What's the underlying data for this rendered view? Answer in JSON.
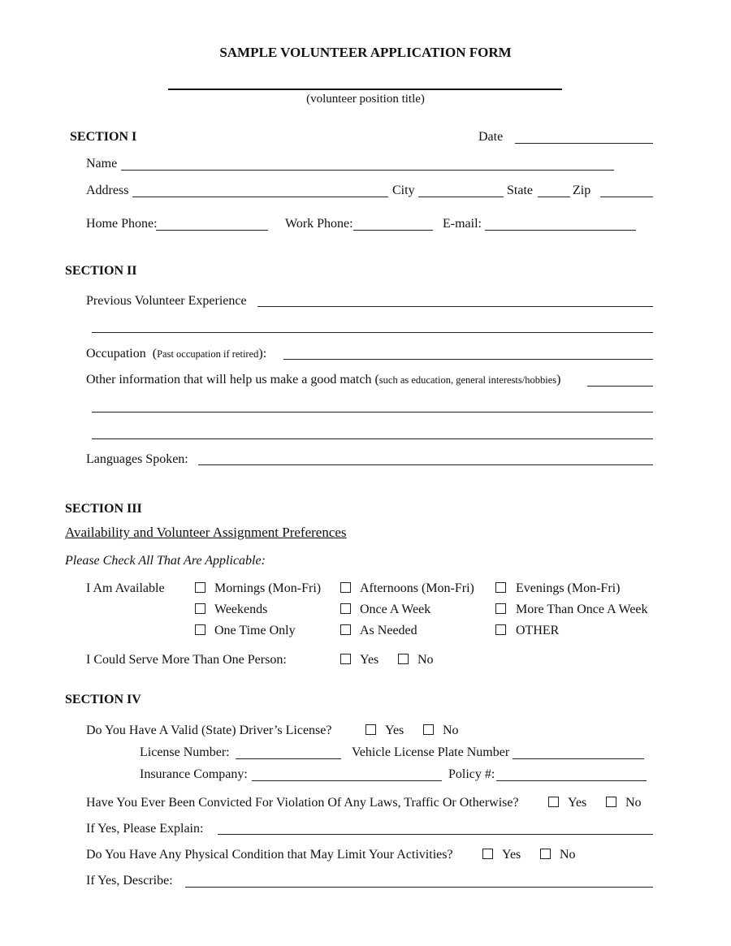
{
  "title": "SAMPLE VOLUNTEER APPLICATION FORM",
  "position_title_caption": "(volunteer position title)",
  "section1": {
    "heading": "SECTION  I",
    "date_label": "Date",
    "name_label": "Name",
    "address_label": "Address",
    "city_label": "City",
    "state_label": "State",
    "zip_label": "Zip",
    "home_phone_label": "Home Phone:",
    "work_phone_label": "Work Phone:",
    "email_label": "E-mail:"
  },
  "section2": {
    "heading": "SECTION  II",
    "prev_experience_label": "Previous Volunteer Experience",
    "occupation_label": "Occupation",
    "occupation_note_open": "(",
    "occupation_note": "Past occupation if retired",
    "occupation_note_close": "):",
    "other_info_label": "Other information that will help us make a good match (",
    "other_info_note": "such as education, general interests/hobbies",
    "other_info_close": ")",
    "languages_label": "Languages Spoken:"
  },
  "section3": {
    "heading": "SECTION  III",
    "subheading": "Availability and Volunteer Assignment Preferences",
    "instruction": "Please Check All That Are Applicable:",
    "available_label": "I Am Available",
    "options": [
      "Mornings (Mon-Fri)",
      "Afternoons (Mon-Fri)",
      "Evenings (Mon-Fri)",
      "Weekends",
      "Once A Week",
      "More Than Once A Week",
      "One Time Only",
      "As Needed",
      "OTHER"
    ],
    "more_than_one_label": "I Could Serve More Than One Person:",
    "yes": "Yes",
    "no": "No"
  },
  "section4": {
    "heading": "SECTION  IV",
    "license_question": "Do You Have A Valid  (State) Driver’s License?",
    "license_number_label": "License Number:",
    "plate_label": "Vehicle License Plate Number",
    "insurance_label": "Insurance Company:",
    "policy_label": "Policy #:",
    "convicted_question": "Have You Ever Been Convicted For Violation Of Any Laws, Traffic Or Otherwise?",
    "explain_label": "If Yes, Please Explain:",
    "physical_question": "Do You Have Any Physical Condition that May Limit Your Activities?",
    "describe_label": "If Yes, Describe:",
    "yes": "Yes",
    "no": "No"
  }
}
